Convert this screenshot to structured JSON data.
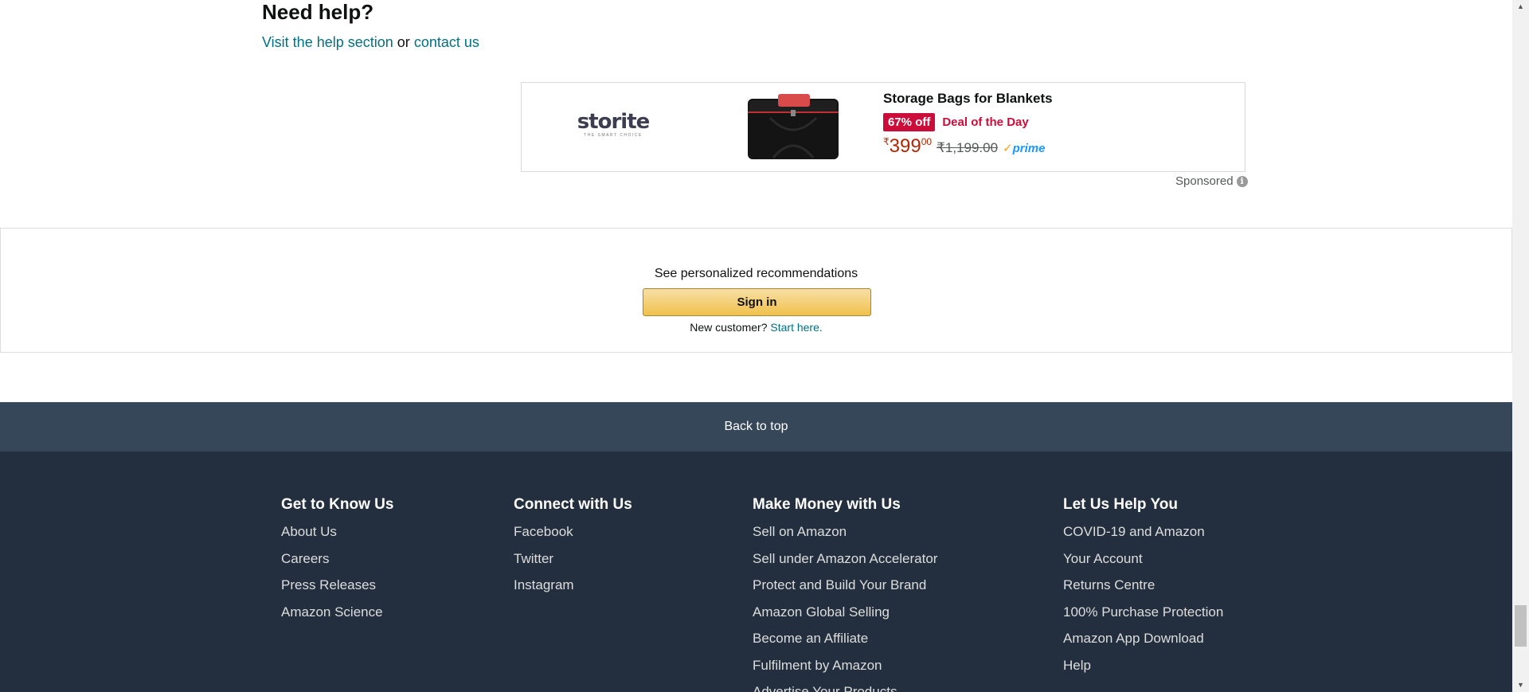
{
  "help": {
    "title": "Need help?",
    "help_link": "Visit the help section",
    "or": "or",
    "contact_link": "contact us"
  },
  "ad": {
    "brand_logo_text": "storite",
    "brand_tagline": "THE SMART CHOICE",
    "title": "Storage Bags for Blankets",
    "discount": "67% off",
    "deal": "Deal of the Day",
    "currency": "₹",
    "price_whole": "399",
    "price_fraction": "00",
    "list_price": "₹1,199.00",
    "prime_check": "✓",
    "prime": "prime",
    "sponsored": "Sponsored",
    "info_icon": "i"
  },
  "signin": {
    "prompt": "See personalized recommendations",
    "button": "Sign in",
    "new_customer": "New customer?",
    "start_here": "Start here."
  },
  "footer": {
    "back_to_top": "Back to top",
    "columns": [
      {
        "title": "Get to Know Us",
        "items": [
          "About Us",
          "Careers",
          "Press Releases",
          "Amazon Science"
        ]
      },
      {
        "title": "Connect with Us",
        "items": [
          "Facebook",
          "Twitter",
          "Instagram"
        ]
      },
      {
        "title": "Make Money with Us",
        "items": [
          "Sell on Amazon",
          "Sell under Amazon Accelerator",
          "Protect and Build Your Brand",
          "Amazon Global Selling",
          "Become an Affiliate",
          "Fulfilment by Amazon",
          "Advertise Your Products"
        ]
      },
      {
        "title": "Let Us Help You",
        "items": [
          "COVID-19 and Amazon",
          "Your Account",
          "Returns Centre",
          "100% Purchase Protection",
          "Amazon App Download",
          "Help"
        ]
      }
    ]
  },
  "scrollbar": {
    "up_icon": "▲",
    "down_icon": "▼"
  }
}
